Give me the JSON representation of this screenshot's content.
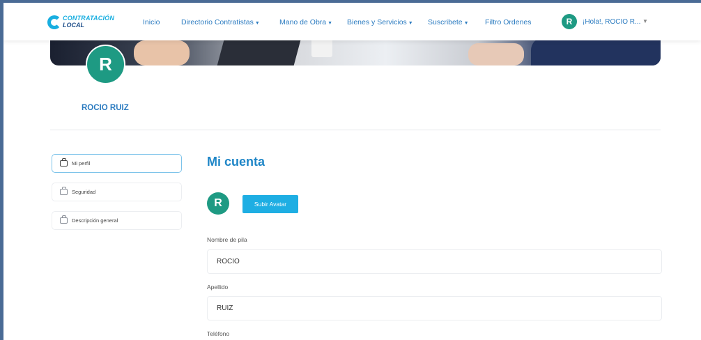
{
  "nav": {
    "logo_line1": "CONTRATACIÓN",
    "logo_line2": "LOCAL",
    "items": [
      {
        "label": "Inicio"
      },
      {
        "label": "Directorio Contratistas"
      },
      {
        "label": "Mano de Obra"
      },
      {
        "label": "Bienes y Servicios"
      },
      {
        "label": "Suscribete"
      },
      {
        "label": "Filtro Ordenes"
      }
    ],
    "avatar_letter": "R",
    "greeting": "¡Hola!, ROCIO R..."
  },
  "profile": {
    "avatar_letter": "R",
    "name": "ROCIO RUIZ"
  },
  "sidebar": {
    "items": [
      {
        "label": "Mi perfil",
        "icon": "id-card-icon"
      },
      {
        "label": "Seguridad",
        "icon": "lock-icon"
      },
      {
        "label": "Descripción general",
        "icon": "lock-icon"
      }
    ]
  },
  "main": {
    "title": "Mi cuenta",
    "avatar_letter": "R",
    "upload_label": "Subir Avatar",
    "fields": [
      {
        "label": "Nombre de pila",
        "value": "ROCIO"
      },
      {
        "label": "Apellido",
        "value": "RUIZ"
      },
      {
        "label": "Teléfono",
        "value": ""
      }
    ]
  },
  "colors": {
    "accent": "#1eaee3",
    "title_blue": "#1f86c7",
    "avatar_green": "#1e9a83",
    "outer_bg": "#4a6b95"
  }
}
